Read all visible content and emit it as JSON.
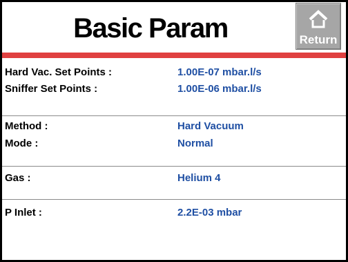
{
  "header": {
    "title": "Basic Param",
    "return_label": "Return",
    "return_icon": "home-icon"
  },
  "groups": [
    {
      "rows": [
        {
          "label": "Hard Vac. Set Points :",
          "value": "1.00E-07 mbar.l/s"
        },
        {
          "label": "Sniffer Set Points :",
          "value": "1.00E-06 mbar.l/s"
        }
      ]
    },
    {
      "rows": [
        {
          "label": "Method :",
          "value": "Hard Vacuum"
        },
        {
          "label": "Mode :",
          "value": "Normal"
        }
      ]
    },
    {
      "rows": [
        {
          "label": "Gas :",
          "value": "Helium 4"
        }
      ]
    },
    {
      "rows": [
        {
          "label": "P Inlet :",
          "value": "2.2E-03 mbar"
        }
      ]
    }
  ],
  "colors": {
    "accent_bar": "#e04040",
    "value_text": "#1f4fa3",
    "button_bg": "#a6a6a6"
  }
}
